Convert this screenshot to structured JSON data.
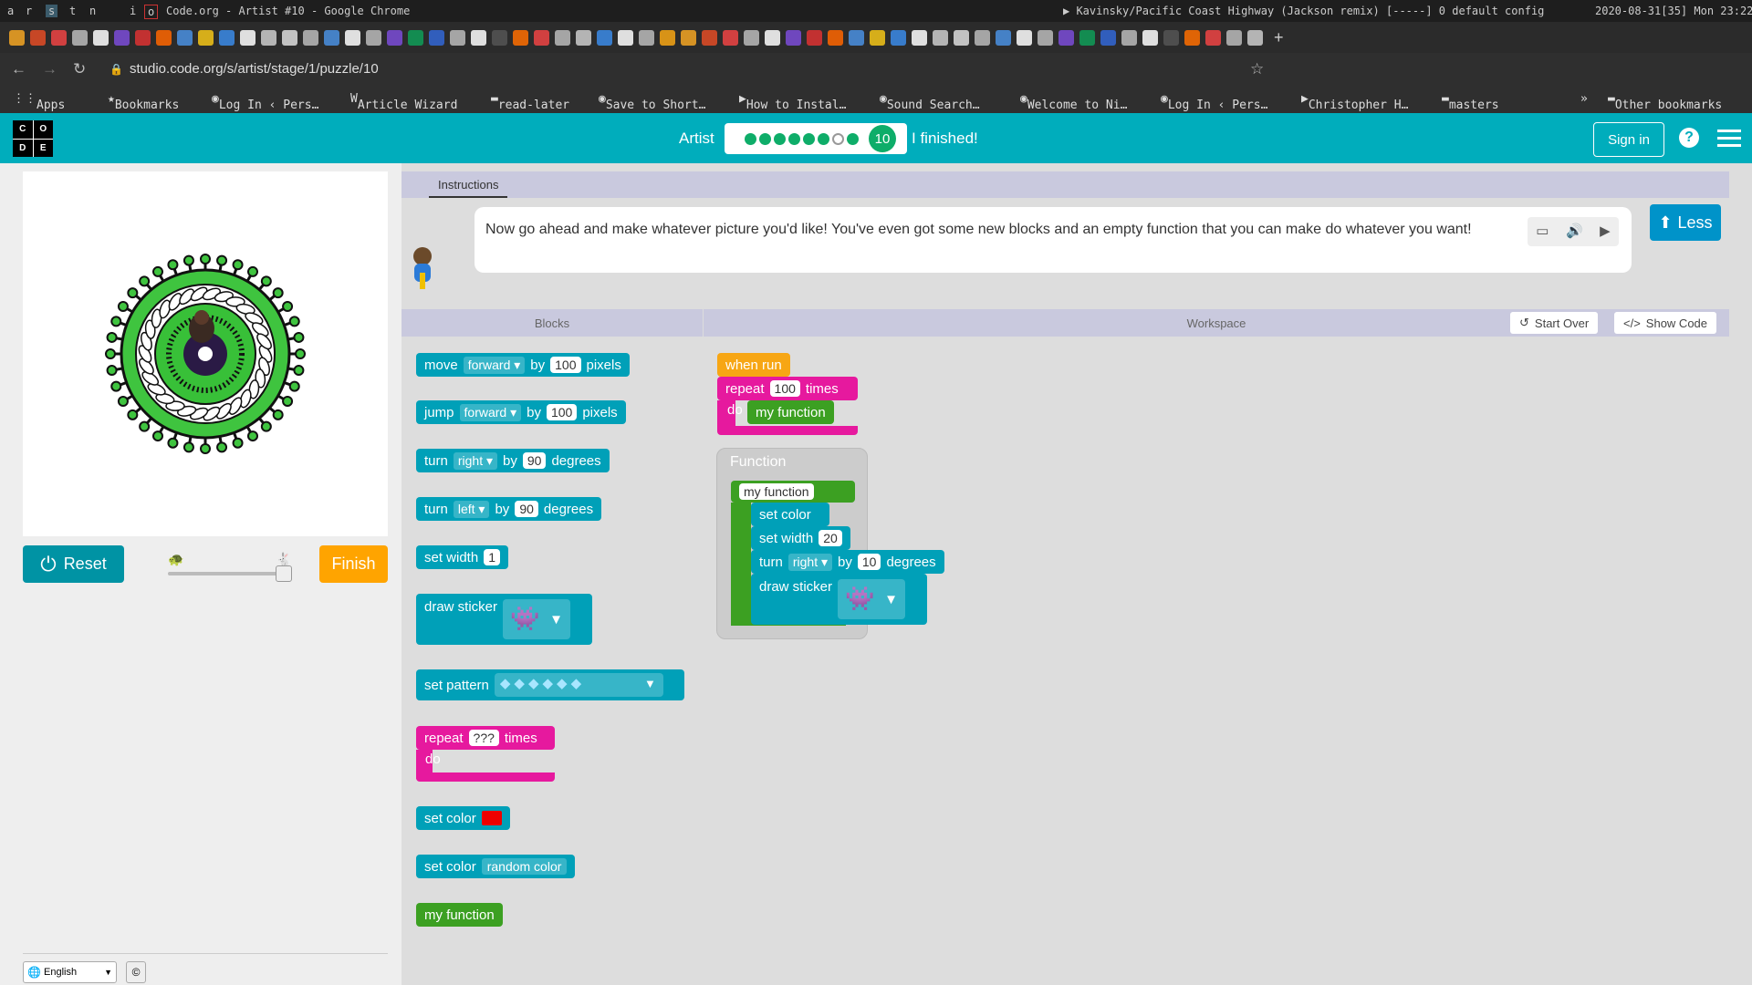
{
  "os": {
    "workspace_letters": [
      "a",
      "r",
      "s",
      "t",
      "n",
      "i",
      "o"
    ],
    "window_title": "Code.org - Artist #10 - Google Chrome",
    "now_playing": "▶ Kavinsky/Pacific Coast Highway (Jackson remix) [-----] 0 default config",
    "clock": "2020-08-31[35] Mon 23:22"
  },
  "browser": {
    "url": "studio.code.org/s/artist/stage/1/puzzle/10",
    "bookmarks": [
      "Apps",
      "Bookmarks",
      "Log In ‹ Pers…",
      "Article Wizard",
      "read-later",
      "Save to Short…",
      "How to Instal…",
      "Sound Search…",
      "Welcome to Ni…",
      "Log In ‹ Pers…",
      "Christopher H…",
      "masters"
    ],
    "overflow": "»",
    "other_bookmarks": "Other bookmarks",
    "new_tab": "+",
    "tab_close": "✕"
  },
  "header": {
    "logo_letters": [
      "C",
      "O",
      "D",
      "E"
    ],
    "level_name": "Artist",
    "current_level": "10",
    "finished_label": "I finished!",
    "sign_in": "Sign in",
    "help": "?",
    "progress_dots": [
      "done",
      "done",
      "done",
      "done",
      "done",
      "done",
      "empty",
      "done",
      "done"
    ]
  },
  "left": {
    "reset": "Reset",
    "finish": "Finish",
    "speed": 1.0,
    "language": "English",
    "copyright": "©"
  },
  "instructions": {
    "tab": "Instructions",
    "text": "Now go ahead and make whatever picture you'd like! You've even got some new blocks and an empty function that you can make do whatever you want!",
    "less": "Less"
  },
  "toolbox": {
    "title": "Blocks",
    "move": {
      "label": "move",
      "dir": "forward",
      "by": "by",
      "value": "100",
      "unit": "pixels"
    },
    "jump": {
      "label": "jump",
      "dir": "forward",
      "by": "by",
      "value": "100",
      "unit": "pixels"
    },
    "turn_right": {
      "label": "turn",
      "dir": "right",
      "by": "by",
      "value": "90",
      "unit": "degrees"
    },
    "turn_left": {
      "label": "turn",
      "dir": "left",
      "by": "by",
      "value": "90",
      "unit": "degrees"
    },
    "set_width": {
      "label": "set width",
      "value": "1"
    },
    "draw_sticker": "draw sticker",
    "set_pattern": "set pattern",
    "repeat": {
      "label": "repeat",
      "value": "???",
      "times": "times",
      "do": "do"
    },
    "set_color": "set color",
    "set_color_random": {
      "label": "set color",
      "value": "random color"
    },
    "my_function": "my function",
    "colors": {
      "swatch": "#ee0000"
    }
  },
  "workspace": {
    "title": "Workspace",
    "start_over": "Start Over",
    "show_code": "Show Code",
    "when_run": "when run",
    "repeat": {
      "label": "repeat",
      "value": "100",
      "times": "times",
      "do": "do"
    },
    "call": "my function",
    "function_title": "Function",
    "function_name": "my function",
    "set_color": "set color",
    "set_width": {
      "label": "set width",
      "value": "20"
    },
    "turn": {
      "label": "turn",
      "dir": "right",
      "by": "by",
      "value": "10",
      "unit": "degrees"
    },
    "draw_sticker": "draw sticker"
  }
}
